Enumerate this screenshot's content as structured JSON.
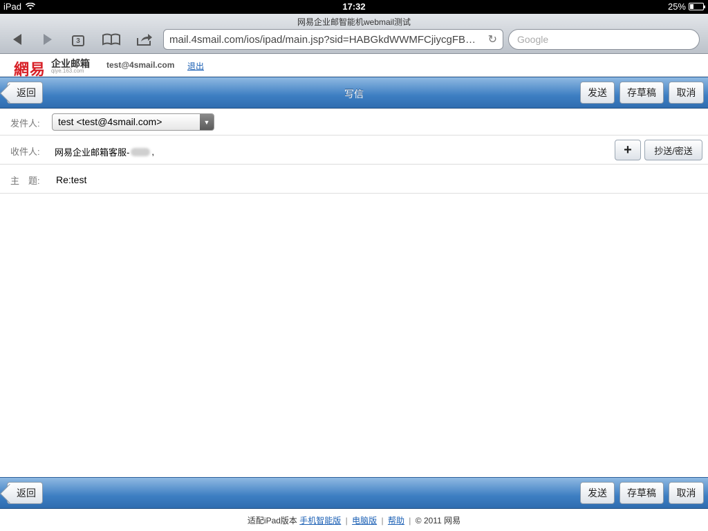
{
  "status_bar": {
    "carrier": "iPad",
    "time": "17:32",
    "battery_text": "25%",
    "battery_level": 0.25
  },
  "browser": {
    "page_title": "网易企业邮智能机webmail测试",
    "tab_count": "3",
    "url": "mail.4smail.com/ios/ipad/main.jsp?sid=HABGkdWWMFCjiycgFBW…",
    "search_placeholder": "Google"
  },
  "header": {
    "logo_main": "網易",
    "logo_sub": "企业邮箱",
    "logo_domain": "qiye.163.com",
    "user_email": "test@4smail.com",
    "logout": "退出"
  },
  "toolbar": {
    "title": "写信",
    "back": "返回",
    "send": "发送",
    "save_draft": "存草稿",
    "cancel": "取消"
  },
  "compose": {
    "from_label": "发件人:",
    "from_value": "test <test@4smail.com>",
    "to_label": "收件人:",
    "to_value_prefix": "网易企业邮箱客服-",
    "to_value_suffix": ",",
    "add_recipient": "+",
    "cc_bcc": "抄送/密送",
    "subject_label": "主　题:",
    "subject_value": "Re:test"
  },
  "footer": {
    "prefix": "适配iPad版本",
    "mobile_link": "手机智能版",
    "desktop_link": "电脑版",
    "help_link": "帮助",
    "copyright": "© 2011 网易",
    "separator": "|"
  }
}
